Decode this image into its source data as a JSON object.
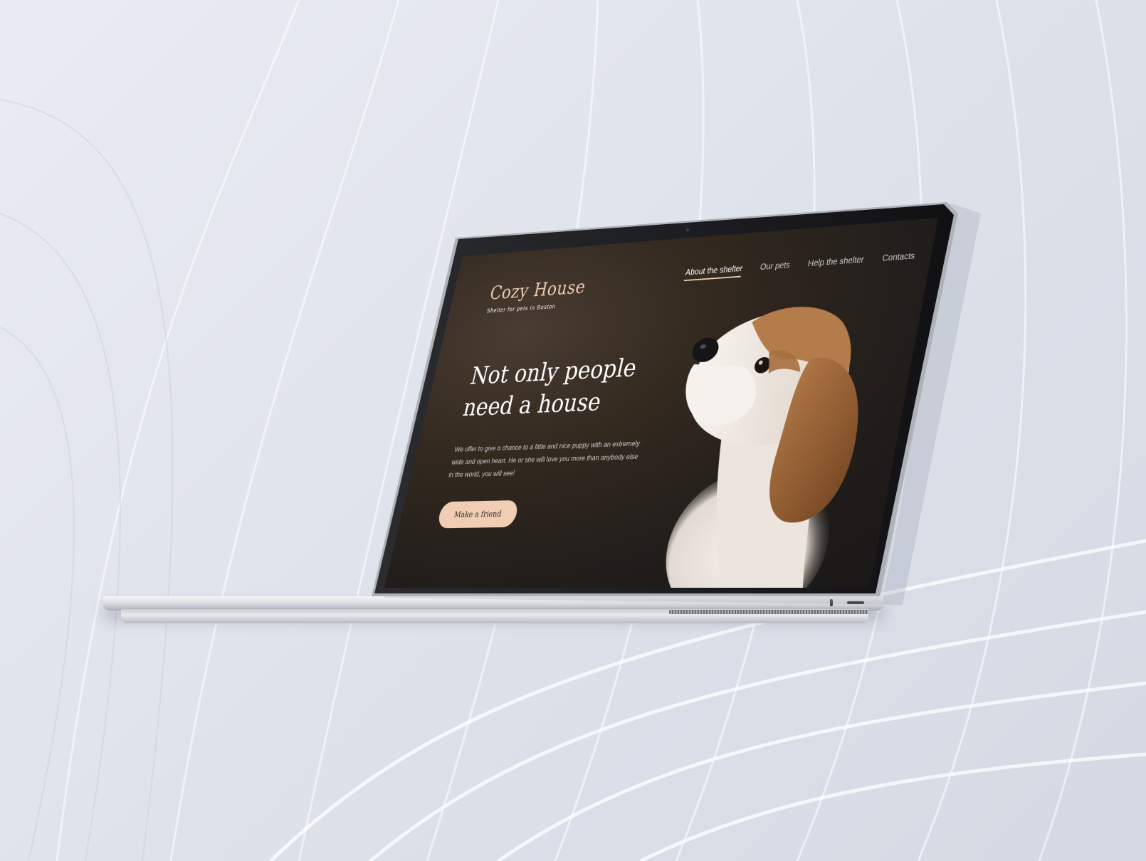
{
  "site": {
    "logo": {
      "title": "Cozy House",
      "subtitle": "Shelter for pets in Boston"
    },
    "nav": {
      "items": [
        {
          "label": "About the shelter",
          "active": true
        },
        {
          "label": "Our pets",
          "active": false
        },
        {
          "label": "Help the shelter",
          "active": false
        },
        {
          "label": "Contacts",
          "active": false
        }
      ]
    },
    "hero": {
      "title_line1": "Not only people",
      "title_line2": "need a house",
      "text": "We offer to give a chance to a little and nice puppy with an extremely wide and open heart. He or she will love you more than anybody else in the world, you will see!",
      "cta_label": "Make a friend"
    }
  },
  "colors": {
    "accent": "#f1cdb3",
    "background_dark": "#1f1c1a",
    "laptop_frame": "#0e0e10",
    "scene_background": "#dde1ea"
  },
  "icons": {
    "camera": "camera-dot-icon",
    "puppy": "puppy-illustration"
  }
}
